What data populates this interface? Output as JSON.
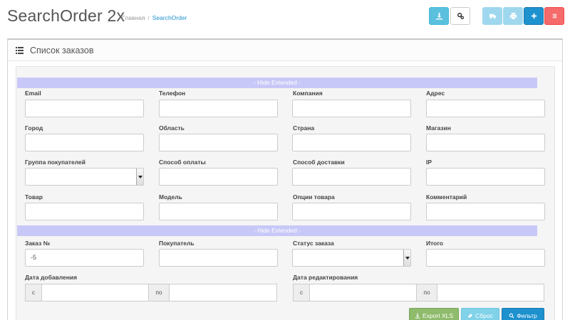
{
  "header": {
    "title": "SearchOrder 2x",
    "breadcrumb": {
      "home": "Главная",
      "current": "SearchOrder"
    }
  },
  "toolbar": {
    "left": [
      {
        "icon": "download-icon",
        "color": "#5bc0de"
      },
      {
        "icon": "cogs-icon",
        "color": "#ffffff"
      }
    ],
    "right": [
      {
        "icon": "truck-icon",
        "color": "#9fd8ee"
      },
      {
        "icon": "print-icon",
        "color": "#9fd8ee"
      },
      {
        "icon": "plus-icon",
        "color": "#1e91cf"
      },
      {
        "icon": "menu-icon",
        "color": "#f56b6b"
      }
    ]
  },
  "panel": {
    "title": "Список заказов"
  },
  "extended_bar": {
    "label_top": "- Hide Extended -",
    "label_bottom": "- Hide Extended -"
  },
  "extended_fields": {
    "email": "Email",
    "phone": "Телефон",
    "company": "Компания",
    "address": "Адрес",
    "city": "Город",
    "region": "Область",
    "country": "Страна",
    "store": "Магазин",
    "customer_group": "Группа покупателей",
    "payment_method": "Способ оплаты",
    "shipping_method": "Способ доставки",
    "ip": "IP",
    "product": "Товар",
    "model": "Модель",
    "product_options": "Опции товара",
    "comment": "Комментарий"
  },
  "main_fields": {
    "order_id": {
      "label": "Заказ №",
      "value": "-5"
    },
    "customer": "Покупатель",
    "order_status": "Статус заказа",
    "total": "Итого",
    "date_added": "Дата добавления",
    "date_modified": "Дата редактирования",
    "from": "с",
    "to": "по"
  },
  "actions": {
    "export": "Export XLS",
    "reset": "Сброс",
    "filter": "Фильтр"
  }
}
